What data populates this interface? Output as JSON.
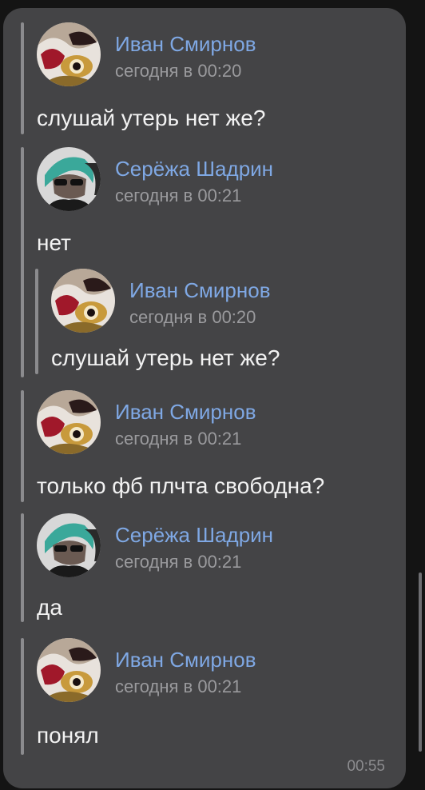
{
  "messages": [
    {
      "name": "Иван Смирнов",
      "time": "сегодня в 00:20",
      "text": "слушай утерь нет же?",
      "avatar": "ivan-avatar"
    },
    {
      "name": "Серёжа Шадрин",
      "time": "сегодня в 00:21",
      "text": "нет",
      "avatar": "serezha-avatar",
      "quote": {
        "name": "Иван Смирнов",
        "time": "сегодня в 00:20",
        "text": "слушай утерь нет же?",
        "avatar": "ivan-avatar"
      }
    },
    {
      "name": "Иван Смирнов",
      "time": "сегодня в 00:21",
      "text": "только фб плчта свободна?",
      "avatar": "ivan-avatar"
    },
    {
      "name": "Серёжа Шадрин",
      "time": "сегодня в 00:21",
      "text": "да",
      "avatar": "serezha-avatar"
    },
    {
      "name": "Иван Смирнов",
      "time": "сегодня в 00:21",
      "text": "понял",
      "avatar": "ivan-avatar"
    }
  ],
  "bubble_time": "00:55",
  "colors": {
    "bubble": "#444446",
    "name": "#7fa8e4",
    "meta": "#9a9a9d",
    "text": "#f2f2f2"
  }
}
